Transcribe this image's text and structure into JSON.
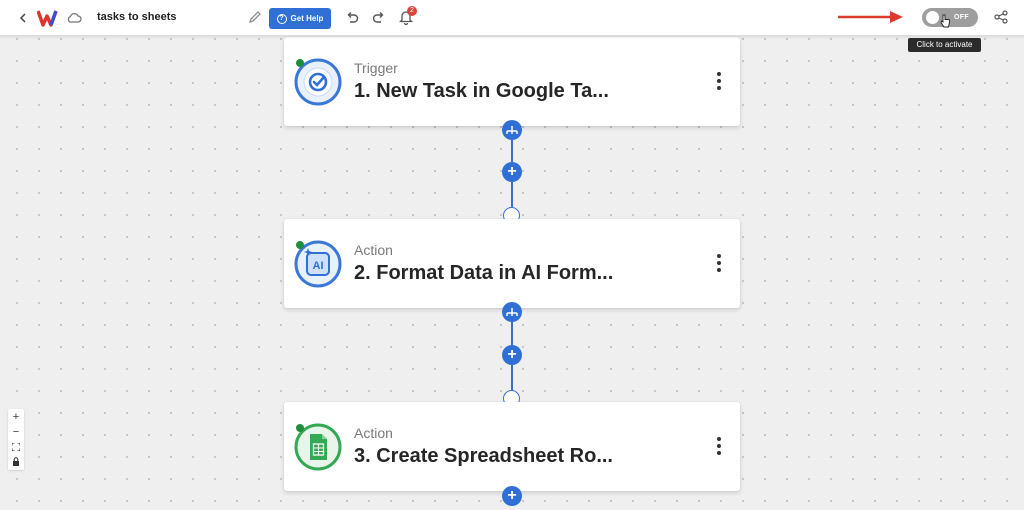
{
  "header": {
    "title": "tasks to sheets",
    "help_label": "Get Help",
    "notification_count": "2",
    "toggle_label": "OFF",
    "tooltip": "Click to activate"
  },
  "steps": [
    {
      "kind": "Trigger",
      "name": "1. New Task in Google Ta...",
      "icon": "google-tasks-icon",
      "accent": "#2f6fd6"
    },
    {
      "kind": "Action",
      "name": "2. Format Data in AI Form...",
      "icon": "ai-formatter-icon",
      "accent": "#2f6fd6"
    },
    {
      "kind": "Action",
      "name": "3. Create Spreadsheet Ro...",
      "icon": "google-sheets-icon",
      "accent": "#34a853"
    }
  ],
  "colors": {
    "primary": "#2f6fd6",
    "status_active": "#1e8e3e",
    "badge": "#d9453b",
    "arrow": "#d93a2b"
  }
}
